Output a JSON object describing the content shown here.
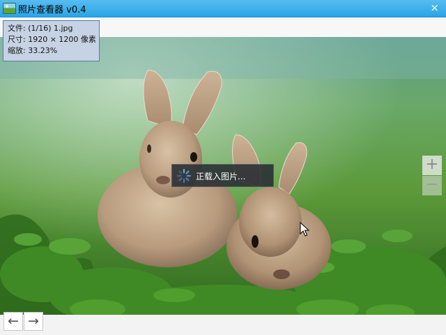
{
  "window": {
    "title": "照片查看器  v0.4",
    "close_glyph": "×"
  },
  "info": {
    "file_line": "文件: (1/16) 1.jpg",
    "size_line": "尺寸: 1920 × 1200 像素",
    "zoom_line": "缩放: 33.23%"
  },
  "loading": {
    "text": "正载入图片..."
  },
  "zoom": {
    "in_glyph": "+",
    "out_glyph": "−"
  },
  "nav": {
    "prev_glyph": "←",
    "next_glyph": "→"
  },
  "photo": {
    "subject": "two-rabbits-in-grass"
  },
  "colors": {
    "titlebar": "#2aa5e6",
    "info_bg": "#c6d3e4",
    "info_border": "#5b7a9c",
    "loading_bg": "#282c32"
  }
}
